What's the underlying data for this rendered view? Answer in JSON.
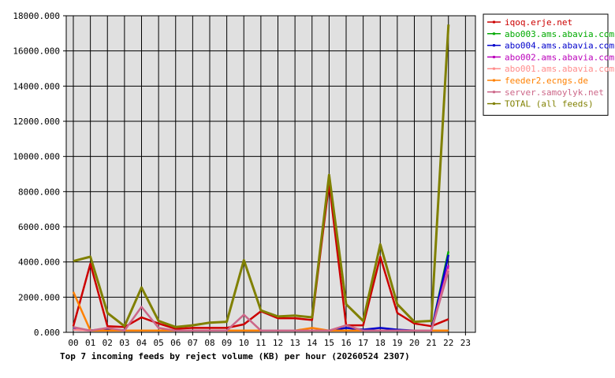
{
  "chart_data": {
    "type": "line",
    "title": "Top 7 incoming feeds by reject volume (KB) per hour (20260524 2307)",
    "x": [
      "00",
      "01",
      "02",
      "03",
      "04",
      "05",
      "06",
      "07",
      "08",
      "09",
      "10",
      "11",
      "12",
      "13",
      "14",
      "15",
      "16",
      "17",
      "18",
      "19",
      "20",
      "21",
      "22",
      "23"
    ],
    "y_ticks": [
      "0.000",
      "2000.000",
      "4000.000",
      "6000.000",
      "8000.000",
      "10000.000",
      "12000.000",
      "14000.000",
      "16000.000",
      "18000.000"
    ],
    "ylim": [
      0,
      18000
    ],
    "grid": true,
    "legend_position": "right",
    "series": [
      {
        "name": "iqoq.erje.net",
        "color": "#cc0000",
        "values": [
          350,
          3900,
          350,
          300,
          850,
          500,
          200,
          250,
          250,
          250,
          450,
          1200,
          800,
          800,
          700,
          8500,
          400,
          400,
          4300,
          1100,
          500,
          350,
          750,
          null
        ]
      },
      {
        "name": "abo003.ams.abavia.com",
        "color": "#00aa00",
        "values": [
          250,
          100,
          200,
          100,
          100,
          100,
          100,
          100,
          100,
          100,
          100,
          100,
          100,
          100,
          100,
          100,
          100,
          100,
          100,
          100,
          100,
          100,
          4600,
          null
        ]
      },
      {
        "name": "abo004.ams.abavia.com",
        "color": "#0000cc",
        "values": [
          250,
          100,
          200,
          100,
          100,
          100,
          100,
          100,
          100,
          100,
          100,
          100,
          100,
          100,
          100,
          100,
          250,
          150,
          250,
          150,
          100,
          100,
          4400,
          null
        ]
      },
      {
        "name": "abo002.ams.abavia.com",
        "color": "#bb00bb",
        "values": [
          150,
          100,
          100,
          100,
          100,
          100,
          100,
          100,
          100,
          100,
          100,
          100,
          100,
          100,
          100,
          100,
          100,
          100,
          100,
          100,
          100,
          100,
          3800,
          null
        ]
      },
      {
        "name": "abo001.ams.abavia.com",
        "color": "#ff8c8c",
        "values": [
          150,
          100,
          100,
          100,
          100,
          100,
          100,
          100,
          100,
          100,
          100,
          100,
          100,
          100,
          100,
          100,
          100,
          100,
          100,
          100,
          100,
          100,
          3600,
          null
        ]
      },
      {
        "name": "feeder2.ecngs.de",
        "color": "#ff8000",
        "values": [
          2300,
          100,
          100,
          100,
          100,
          100,
          100,
          100,
          100,
          100,
          100,
          100,
          100,
          100,
          250,
          100,
          100,
          100,
          100,
          100,
          100,
          100,
          100,
          null
        ]
      },
      {
        "name": "server.samoylyk.net",
        "color": "#cc6688",
        "values": [
          300,
          100,
          250,
          100,
          1450,
          250,
          100,
          100,
          100,
          100,
          1000,
          100,
          100,
          100,
          100,
          100,
          400,
          100,
          100,
          100,
          100,
          100,
          3500,
          null
        ]
      },
      {
        "name": "TOTAL (all feeds)",
        "color": "#808000",
        "values": [
          4050,
          4300,
          1100,
          350,
          2550,
          650,
          300,
          400,
          550,
          600,
          4100,
          1250,
          900,
          950,
          850,
          8950,
          1600,
          650,
          5000,
          1600,
          600,
          650,
          17500,
          null
        ]
      }
    ]
  }
}
